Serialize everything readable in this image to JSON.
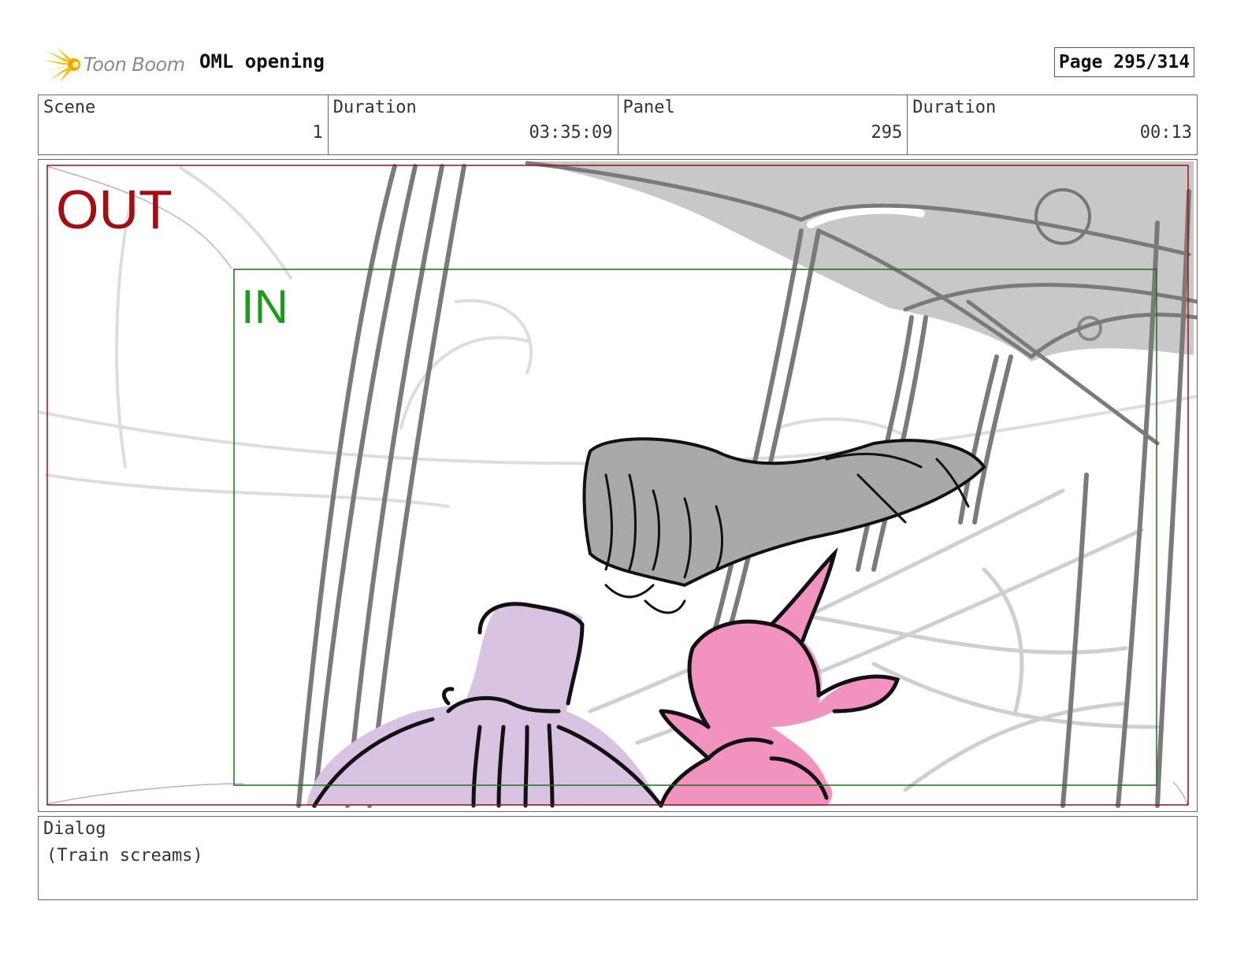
{
  "header": {
    "logo_text": "Toon Boom",
    "project_title": "OML opening",
    "page_label": "Page 295/314"
  },
  "info": {
    "scene_label": "Scene",
    "scene_value": "1",
    "scene_duration_label": "Duration",
    "scene_duration_value": "03:35:09",
    "panel_label": "Panel",
    "panel_value": "295",
    "panel_duration_label": "Duration",
    "panel_duration_value": "00:13"
  },
  "panel": {
    "out_label": "OUT",
    "in_label": "IN",
    "out_frame_color": "#a10f14",
    "in_frame_color": "#1c6e1c"
  },
  "dialog": {
    "label": "Dialog",
    "text": "(Train screams)"
  }
}
